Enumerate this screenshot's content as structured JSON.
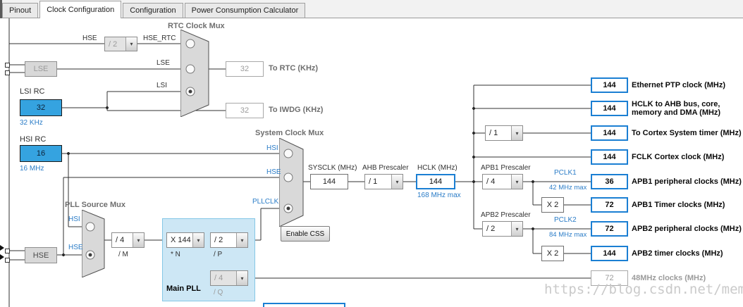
{
  "tabs": {
    "items": [
      {
        "label": "Pinout"
      },
      {
        "label": "Clock Configuration"
      },
      {
        "label": "Configuration"
      },
      {
        "label": "Power Consumption Calculator"
      }
    ],
    "active_index": 1
  },
  "icons": {
    "chevron_down": "▾"
  },
  "left": {
    "lse_label": "LSE",
    "lsi_title": "LSI RC",
    "lsi_value": "32",
    "lsi_freq": "32 KHz",
    "hsi_title": "HSI RC",
    "hsi_value": "16",
    "hsi_freq": "16 MHz",
    "hse_label": "HSE"
  },
  "rtc": {
    "title": "RTC Clock Mux",
    "hse_in": "HSE",
    "divider": "/ 2",
    "hse_rtc": "HSE_RTC",
    "lse_in": "LSE",
    "lsi_in": "LSI",
    "rtc_value": "32",
    "rtc_label": "To RTC (KHz)",
    "iwdg_value": "32",
    "iwdg_label": "To IWDG (KHz)"
  },
  "pll_mux": {
    "title": "PLL Source Mux",
    "hsi_in": "HSI",
    "hse_in": "HSE",
    "m_value": "/ 4",
    "m_label": "/ M"
  },
  "main_pll": {
    "title": "Main PLL",
    "n_value": "X 144",
    "n_label": "* N",
    "p_value": "/ 2",
    "p_label": "/ P",
    "q_value": "/ 4",
    "q_label": "/ Q"
  },
  "sys_mux": {
    "title": "System Clock Mux",
    "hsi_in": "HSI",
    "hse_in": "HSE",
    "pll_in": "PLLCLK",
    "css_button": "Enable CSS"
  },
  "sysclk": {
    "label": "SYSCLK (MHz)",
    "value": "144"
  },
  "ahb": {
    "label": "AHB Prescaler",
    "value": "/ 1"
  },
  "hclk": {
    "label": "HCLK (MHz)",
    "value": "144",
    "max": "168 MHz max"
  },
  "outputs": {
    "ethernet": {
      "value": "144",
      "label": "Ethernet PTP clock (MHz)"
    },
    "hclk_bus": {
      "value": "144",
      "label1": "HCLK to AHB bus, core,",
      "label2": "memory and DMA (MHz)"
    },
    "cortex_div": "/ 1",
    "cortex_timer": {
      "value": "144",
      "label": "To Cortex System timer (MHz)"
    },
    "fclk": {
      "value": "144",
      "label": "FCLK Cortex clock (MHz)"
    },
    "clk48": {
      "value": "72",
      "label": "48MHz clocks (MHz)"
    }
  },
  "apb1": {
    "prescaler_label": "APB1 Prescaler",
    "prescaler_value": "/ 4",
    "pclk": "PCLK1",
    "max": "42 MHz max",
    "periph_value": "36",
    "periph_label": "APB1 peripheral clocks (MHz)",
    "mult": "X 2",
    "timer_value": "72",
    "timer_label": "APB1 Timer clocks (MHz)"
  },
  "apb2": {
    "prescaler_label": "APB2 Prescaler",
    "prescaler_value": "/ 2",
    "pclk": "PCLK2",
    "max": "84 MHz max",
    "periph_value": "72",
    "periph_label": "APB2 peripheral clocks (MHz)",
    "mult": "X 2",
    "timer_value": "144",
    "timer_label": "APB2 timer clocks (MHz)"
  },
  "watermark": "https://blog.csdn.net/memoff",
  "colors": {
    "accent_blue": "#1b7fd3",
    "source_fill": "#35a3e0",
    "label_blue": "#2a7cc7",
    "pll_panel": "#cde7f5"
  }
}
